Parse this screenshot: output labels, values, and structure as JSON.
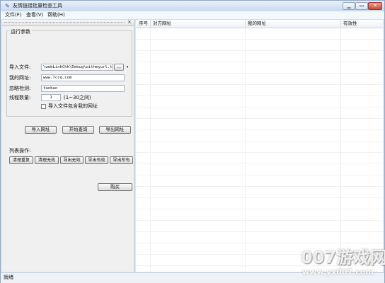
{
  "window": {
    "title": "友情链接批量检查工具",
    "min_glyph": "▁",
    "max_glyph": "▭",
    "close_glyph": "✕"
  },
  "menu": [
    "文件(F)",
    "查看(V)",
    "帮助(H)"
  ],
  "panel": {
    "close_glyph": "×",
    "group_title": "运行参数",
    "import_label": "导入文件:",
    "import_value": "\\webLinkChk\\Debug\\withmyurl.txt",
    "browse_label": "...",
    "dot": "•",
    "my_url_label": "我的网址:",
    "my_url_value": "www.7ccq.com",
    "ignore_label": "忽略检测:",
    "ignore_value": "taobao",
    "threads_label": "线程数量:",
    "threads_value": "1",
    "threads_hint": "(1~30之间)",
    "checkbox_label": "导入文件包含我的网址",
    "checkbox_checked": false,
    "btn_import": "导入网址",
    "btn_start": "开始查询",
    "btn_export": "导出网址",
    "list_ops_label": "列表操作:",
    "list_buttons": [
      "清理重复",
      "清理无效",
      "导出无效",
      "导出有效",
      "导出所有"
    ],
    "btn_buy": "购买"
  },
  "table": {
    "columns": [
      "序号",
      "对方网址",
      "我的网址",
      "有效性"
    ]
  },
  "status": {
    "text": "就绪"
  },
  "watermark": {
    "brand": "007游戏网",
    "url": "www.yx007.com"
  }
}
